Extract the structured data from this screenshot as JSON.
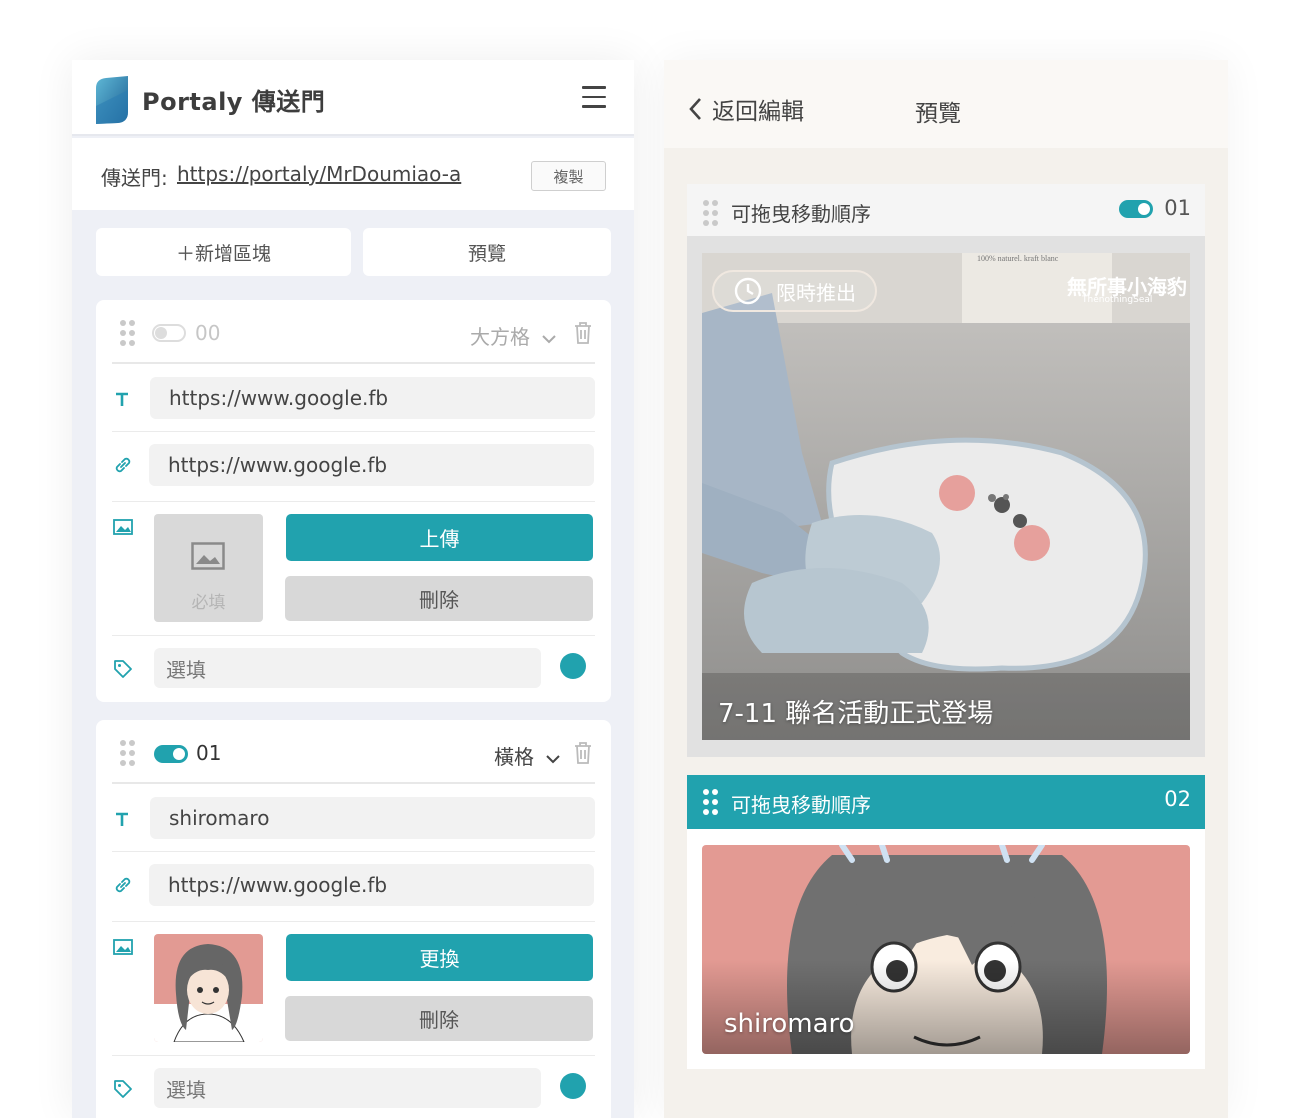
{
  "app": {
    "brand": "Portaly 傳送門",
    "portal_label": "傳送門:",
    "portal_url": "https://portaly/MrDoumiao-a",
    "copy_label": "複製",
    "add_block_label": "＋新增區塊",
    "preview_label": "預覽"
  },
  "blocks": [
    {
      "number": "00",
      "enabled": false,
      "mode": "大方格",
      "title_value": "https://www.google.fb",
      "link_value": "https://www.google.fb",
      "image_placeholder": "必填",
      "upload_label": "上傳",
      "delete_label": "刪除",
      "tag_placeholder": "選填"
    },
    {
      "number": "01",
      "enabled": true,
      "mode": "橫格",
      "title_value": "shiromaro",
      "link_value": "https://www.google.fb",
      "replace_label": "更換",
      "delete_label": "刪除",
      "tag_placeholder": "選填"
    }
  ],
  "preview": {
    "back_label": "返回編輯",
    "title": "預覽",
    "cards": [
      {
        "drag_label": "可拖曳移動順序",
        "number": "01",
        "badge": "限時推出",
        "caption": "7-11 聯名活動正式登場",
        "watermark": "無所事小海豹",
        "watermark_sub": "ThenothingSeal",
        "photo_label": "100% naturel. kraft blanc"
      },
      {
        "drag_label": "可拖曳移動順序",
        "number": "02",
        "caption": "shiromaro"
      }
    ]
  },
  "colors": {
    "accent": "#21a2ae",
    "panel_bg": "#eef0f6",
    "preview_bg": "#f4f1ec"
  },
  "icons": [
    "logo-icon",
    "menu-icon",
    "drag-handle-icon",
    "toggle",
    "chevron-down-icon",
    "trash-icon",
    "text-icon",
    "link-icon",
    "image-icon",
    "tag-icon",
    "clock-icon",
    "back-chevron-icon"
  ]
}
